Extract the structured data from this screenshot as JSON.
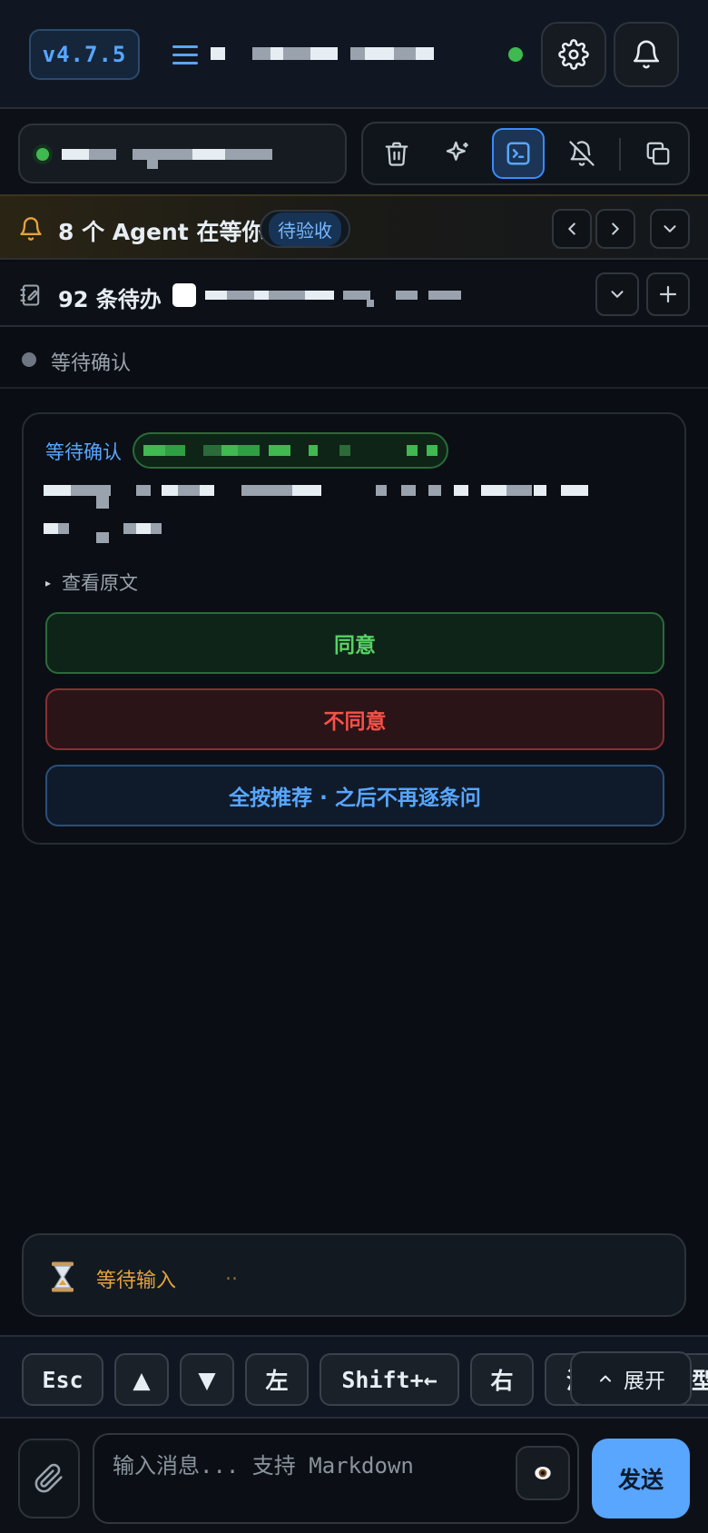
{
  "header": {
    "version": "v4.7.5",
    "icons": [
      "menu-icon",
      "gear-icon",
      "bell-icon"
    ],
    "status_color": "#3fb950"
  },
  "toolbar": {
    "icons": [
      "trash-icon",
      "sparkle-icon",
      "terminal-icon",
      "bell-off-icon",
      "copy-icon"
    ],
    "active_tool": "terminal-icon"
  },
  "agent_banner": {
    "text": "8 个 Agent 在等你",
    "badge": "待验收",
    "icons": [
      "bell-icon",
      "chevron-left-icon",
      "chevron-right-icon",
      "chevron-down-icon"
    ]
  },
  "todo": {
    "text": "92 条待办",
    "icons": [
      "notebook-icon",
      "chevron-down-icon",
      "plus-icon"
    ]
  },
  "section": {
    "label": "等待确认"
  },
  "card": {
    "title": "等待确认",
    "expand_label": "查看原文",
    "agree": "同意",
    "disagree": "不同意",
    "recommend": "全按推荐 · 之后不再逐条问"
  },
  "waiting": {
    "text": "等待输入",
    "dots": "..",
    "icon": "hourglass-icon"
  },
  "keys": {
    "esc": "Esc",
    "up": "▲",
    "down": "▼",
    "left": "左",
    "shift_left": "Shift+←",
    "right": "右",
    "partial_1": "演",
    "partial_2": "型",
    "expand": "展开"
  },
  "composer": {
    "placeholder": "输入消息... 支持 Markdown",
    "preview_icon": "eye-icon",
    "attach_icon": "paperclip-icon",
    "send": "发送"
  },
  "colors": {
    "accent": "#58a6ff",
    "success": "#3fb950",
    "danger": "#f85149",
    "warning": "#e3a33b"
  }
}
